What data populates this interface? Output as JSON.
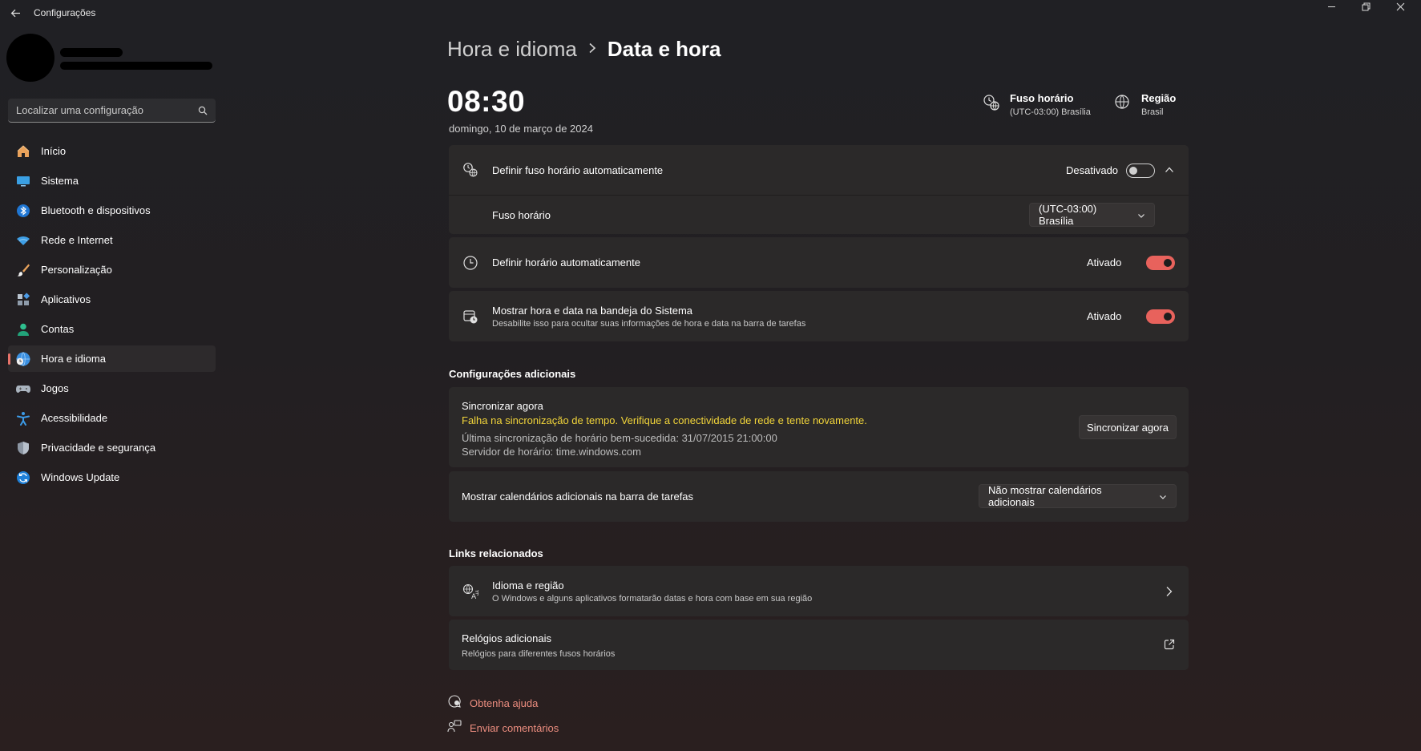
{
  "window": {
    "app_title": "Configurações"
  },
  "search": {
    "placeholder": "Localizar uma configuração"
  },
  "sidebar": {
    "items": [
      {
        "label": "Início",
        "icon": "home-icon"
      },
      {
        "label": "Sistema",
        "icon": "monitor-icon"
      },
      {
        "label": "Bluetooth e dispositivos",
        "icon": "bluetooth-icon"
      },
      {
        "label": "Rede e Internet",
        "icon": "wifi-icon"
      },
      {
        "label": "Personalização",
        "icon": "brush-icon"
      },
      {
        "label": "Aplicativos",
        "icon": "apps-icon"
      },
      {
        "label": "Contas",
        "icon": "person-icon"
      },
      {
        "label": "Hora e idioma",
        "icon": "globe-clock-icon",
        "active": true
      },
      {
        "label": "Jogos",
        "icon": "gamepad-icon"
      },
      {
        "label": "Acessibilidade",
        "icon": "accessibility-icon"
      },
      {
        "label": "Privacidade e segurança",
        "icon": "shield-icon"
      },
      {
        "label": "Windows Update",
        "icon": "update-icon"
      }
    ]
  },
  "breadcrumb": {
    "parent": "Hora e idioma",
    "current": "Data e hora"
  },
  "clock": {
    "time": "08:30",
    "date": "domingo, 10 de março de 2024"
  },
  "header_info": {
    "timezone_title": "Fuso horário",
    "timezone_value": "(UTC-03:00) Brasília",
    "region_title": "Região",
    "region_value": "Brasil"
  },
  "settings": {
    "auto_timezone": {
      "label": "Definir fuso horário automaticamente",
      "state": "Desativado"
    },
    "timezone": {
      "label": "Fuso horário",
      "value": "(UTC-03:00) Brasília"
    },
    "auto_time": {
      "label": "Definir horário automaticamente",
      "state": "Ativado"
    },
    "show_tray": {
      "label": "Mostrar hora e data na bandeja do Sistema",
      "sub": "Desabilite isso para ocultar suas informações de hora e data na barra de tarefas",
      "state": "Ativado"
    }
  },
  "additional": {
    "section_title": "Configurações adicionais",
    "sync_title": "Sincronizar agora",
    "sync_error": "Falha na sincronização de tempo. Verifique a conectividade de rede e tente novamente.",
    "last_sync": "Última sincronização de horário bem-sucedida: 31/07/2015 21:00:00",
    "server": "Servidor de horário: time.windows.com",
    "sync_button": "Sincronizar agora",
    "calendars_label": "Mostrar calendários adicionais na barra de tarefas",
    "calendars_value": "Não mostrar calendários adicionais"
  },
  "related": {
    "section_title": "Links relacionados",
    "lang_title": "Idioma e região",
    "lang_sub": "O Windows e alguns aplicativos formatarão datas e hora com base em sua região",
    "clocks_title": "Relógios adicionais",
    "clocks_sub": "Relógios para diferentes fusos horários"
  },
  "footer": {
    "help": "Obtenha ajuda",
    "feedback": "Enviar comentários"
  },
  "colors": {
    "accent": "#e8625c",
    "warning": "#f1d43a",
    "link": "#ec8d7f"
  }
}
